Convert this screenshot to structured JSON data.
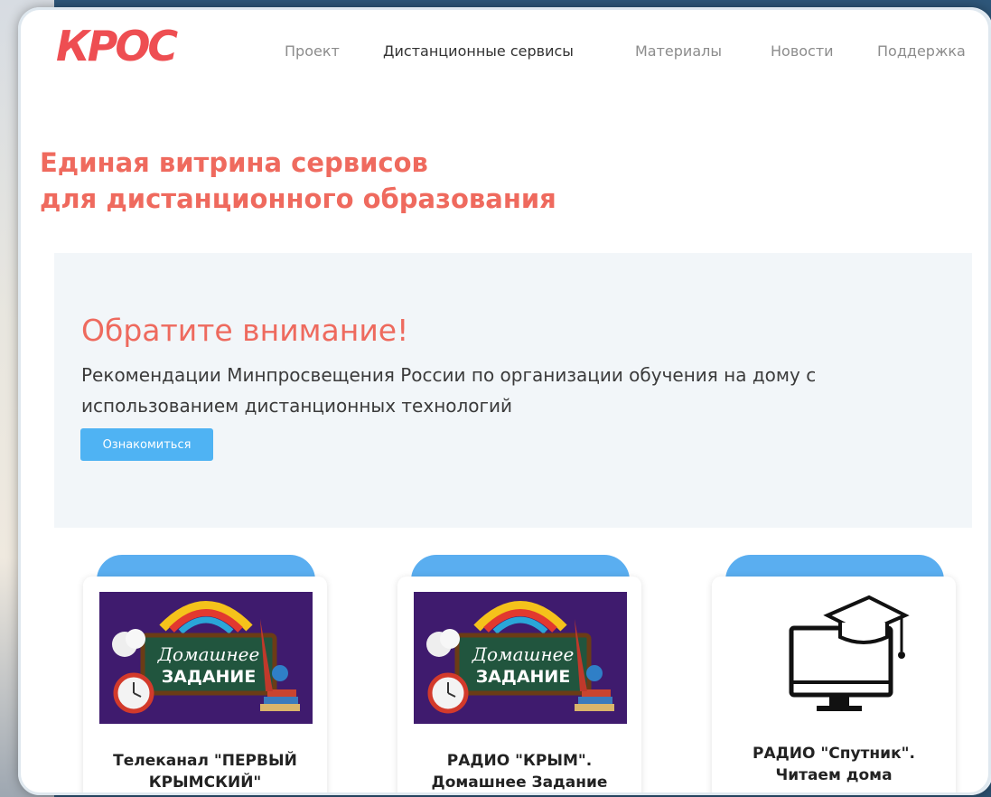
{
  "nav": {
    "logo": "КРОС",
    "items": [
      {
        "label": "Проект",
        "active": false
      },
      {
        "label": "Дистанционные сервисы",
        "active": true
      },
      {
        "label": "Материалы",
        "active": false
      },
      {
        "label": "Новости",
        "active": false
      },
      {
        "label": "Поддержка",
        "active": false
      }
    ]
  },
  "headline": {
    "line1": "Единая витрина сервисов",
    "line2": "для дистанционного образования"
  },
  "notice": {
    "title": "Обратите внимание!",
    "text": "Рекомендации Минпросвещения России по организации обучения на дому с использованием дистанционных технологий",
    "button": "Ознакомиться"
  },
  "cards": [
    {
      "image_caption_1": "Домашнее",
      "image_caption_2": "ЗАДАНИЕ",
      "title_line1": "Телеканал \"ПЕРВЫЙ",
      "title_line2": "КРЫМСКИЙ\"",
      "icon": "homework-banner"
    },
    {
      "image_caption_1": "Домашнее",
      "image_caption_2": "ЗАДАНИЕ",
      "title_line1": "РАДИО \"КРЫМ\".",
      "title_line2": "Домашнее Задание",
      "icon": "homework-banner"
    },
    {
      "title_line1": "РАДИО \"Спутник\".",
      "title_line2": "Читаем дома",
      "icon": "graduation-computer-icon"
    }
  ],
  "colors": {
    "accent": "#ee4e52",
    "headline": "#ef6a5e",
    "button": "#4fb3f3",
    "card_tab": "#5aaef0"
  }
}
